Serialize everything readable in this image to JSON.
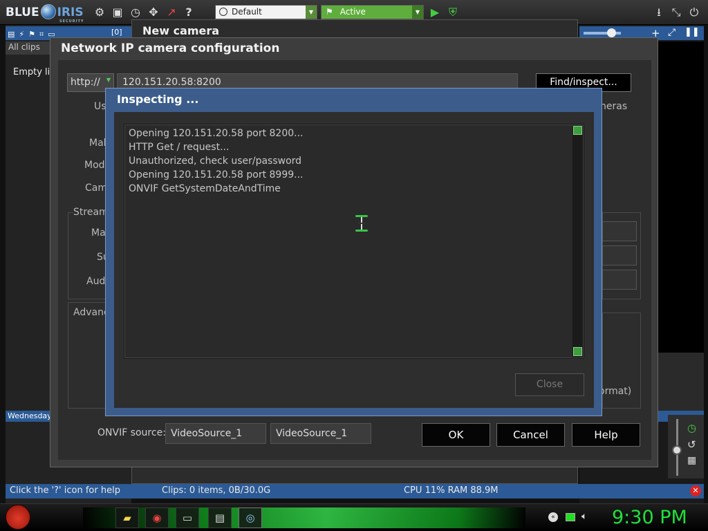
{
  "app": {
    "logo_blue": "BLUE",
    "logo_iris": "IRIS",
    "logo_sub": "SECURITY"
  },
  "toolbar": {
    "icons": [
      "settings-icon",
      "clips-icon",
      "timer-icon",
      "move-icon",
      "chart-icon",
      "help-icon"
    ],
    "profile": "Default",
    "status": "Active",
    "right_icons": [
      "download-icon",
      "restore-icon",
      "power-icon"
    ]
  },
  "left_pane": {
    "counter": "[0]",
    "all_clips": "All clips",
    "empty_list": "Empty lis",
    "day": "Wednesday"
  },
  "new_camera": {
    "title": "New camera"
  },
  "network_dialog": {
    "title": "Network IP camera configuration",
    "protocol": "http://",
    "address": "120.151.20.58:8200",
    "find_button": "Find/inspect...",
    "labels": [
      "Us",
      "Mal",
      "Mod",
      "Cam",
      "Stream",
      "Ma",
      "Su",
      "Aud",
      "Advanc"
    ],
    "cameras_label": "neras",
    "format_label": "ormat)",
    "onvif_label": "ONVIF source:",
    "onvif_source_1": "VideoSource_1",
    "onvif_source_2": "VideoSource_1",
    "ok": "OK",
    "cancel": "Cancel",
    "help": "Help"
  },
  "inspect_dialog": {
    "title": "Inspecting ...",
    "log": [
      "Opening 120.151.20.58 port 8200...",
      "HTTP Get / request...",
      "Unauthorized, check user/password",
      "Opening 120.151.20.58 port 8999...",
      "ONVIF GetSystemDateAndTime"
    ],
    "close": "Close"
  },
  "status_bar": {
    "hint": "Click the '?' icon for help",
    "clips": "Clips: 0 items, 0B/30.0G",
    "cpu": "CPU 11% RAM 88.9M"
  },
  "taskbar": {
    "time": "9:30 PM",
    "apps": [
      "explorer-icon",
      "chrome-icon",
      "window-icon",
      "notepad-icon",
      "blue-iris-icon"
    ]
  },
  "colors": {
    "accent_blue": "#2b5a96",
    "active_green": "#5fae3d",
    "clock_green": "#1ee23a"
  }
}
